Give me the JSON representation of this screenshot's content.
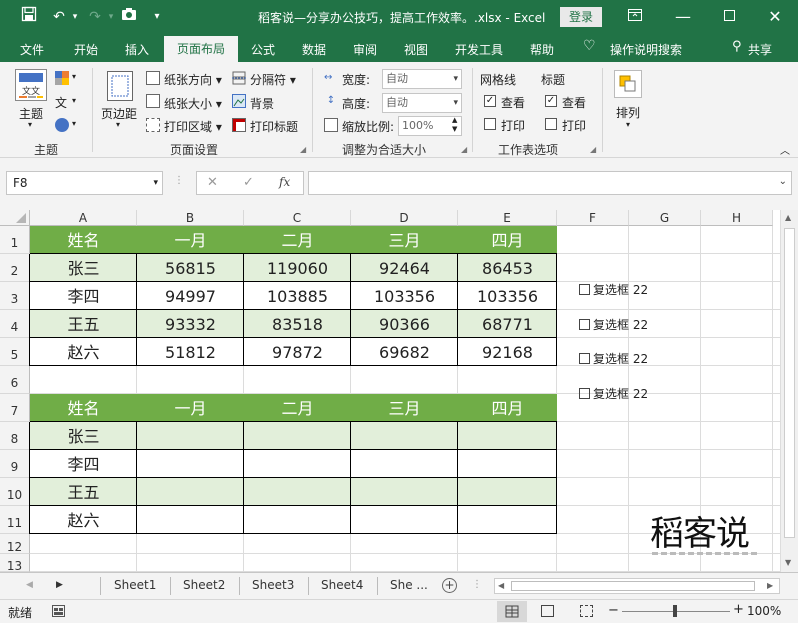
{
  "title_bar": {
    "doc_title": "稻客说—分享办公技巧，提高工作效率。.xlsx - Excel",
    "login": "登录"
  },
  "tabs": [
    "文件",
    "开始",
    "插入",
    "页面布局",
    "公式",
    "数据",
    "审阅",
    "视图",
    "开发工具",
    "帮助"
  ],
  "tell_me": "操作说明搜索",
  "share": "共享",
  "ribbon": {
    "theme": {
      "label": "主题",
      "group": "主题"
    },
    "page_setup": {
      "margins": "页边距",
      "orientation": "纸张方向",
      "size": "纸张大小",
      "print_area": "打印区域",
      "breaks": "分隔符",
      "background": "背景",
      "print_titles": "打印标题",
      "group": "页面设置"
    },
    "scale": {
      "width_label": "宽度:",
      "width_value": "自动",
      "height_label": "高度:",
      "height_value": "自动",
      "scale_label": "缩放比例:",
      "scale_value": "100%",
      "group": "调整为合适大小"
    },
    "sheet_options": {
      "gridlines": "网格线",
      "headings": "标题",
      "view1": "查看",
      "print1": "打印",
      "view2": "查看",
      "print2": "打印",
      "group": "工作表选项"
    },
    "arrange": {
      "label": "排列"
    }
  },
  "name_box": "F8",
  "columns": [
    "A",
    "B",
    "C",
    "D",
    "E",
    "F",
    "G",
    "H"
  ],
  "rows": [
    "1",
    "2",
    "3",
    "4",
    "5",
    "6",
    "7",
    "8",
    "9",
    "10",
    "11",
    "12",
    "13"
  ],
  "table1": {
    "header": [
      "姓名",
      "一月",
      "二月",
      "三月",
      "四月"
    ],
    "rows": [
      [
        "张三",
        "56815",
        "119060",
        "92464",
        "86453"
      ],
      [
        "李四",
        "94997",
        "103885",
        "103356",
        "103356"
      ],
      [
        "王五",
        "93332",
        "83518",
        "90366",
        "68771"
      ],
      [
        "赵六",
        "51812",
        "97872",
        "69682",
        "92168"
      ]
    ]
  },
  "table2": {
    "header": [
      "姓名",
      "一月",
      "二月",
      "三月",
      "四月"
    ],
    "names": [
      "张三",
      "李四",
      "王五",
      "赵六"
    ]
  },
  "checkboxes": [
    "复选框 22",
    "复选框 22",
    "复选框 22",
    "复选框 22"
  ],
  "logo_text": "稻客说",
  "sheets": [
    "Sheet1",
    "Sheet2",
    "Sheet3",
    "Sheet4",
    "She ..."
  ],
  "status": {
    "ready": "就绪",
    "zoom": "100%"
  },
  "colors": {
    "excel_green": "#217346",
    "header_green": "#70ad47",
    "row_light_green": "#e2efda"
  }
}
